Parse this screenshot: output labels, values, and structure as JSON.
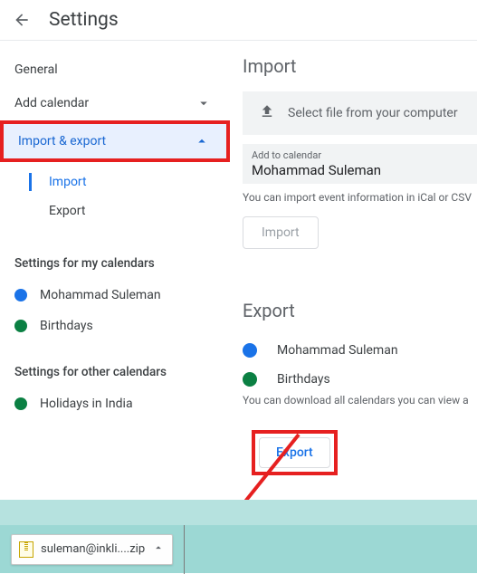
{
  "header": {
    "title": "Settings"
  },
  "sidebar": {
    "general": "General",
    "add_calendar": "Add calendar",
    "import_export": "Import & export",
    "sub": {
      "import": "Import",
      "export": "Export"
    },
    "my_cal_label": "Settings for my calendars",
    "my_cals": [
      {
        "name": "Mohammad Suleman",
        "color": "#1a73e8"
      },
      {
        "name": "Birthdays",
        "color": "#0b8043"
      }
    ],
    "other_cal_label": "Settings for other calendars",
    "other_cals": [
      {
        "name": "Holidays in India",
        "color": "#0b8043"
      }
    ]
  },
  "import": {
    "heading": "Import",
    "select_file": "Select file from your computer",
    "add_to_label": "Add to calendar",
    "add_to_value": "Mohammad Suleman",
    "hint": "You can import event information in iCal or CSV",
    "button": "Import"
  },
  "export": {
    "heading": "Export",
    "items": [
      {
        "name": "Mohammad Suleman",
        "color": "#1a73e8"
      },
      {
        "name": "Birthdays",
        "color": "#0b8043"
      }
    ],
    "hint": "You can download all calendars you can view a",
    "button": "Export"
  },
  "download": {
    "filename": "suleman@inkli....zip"
  }
}
